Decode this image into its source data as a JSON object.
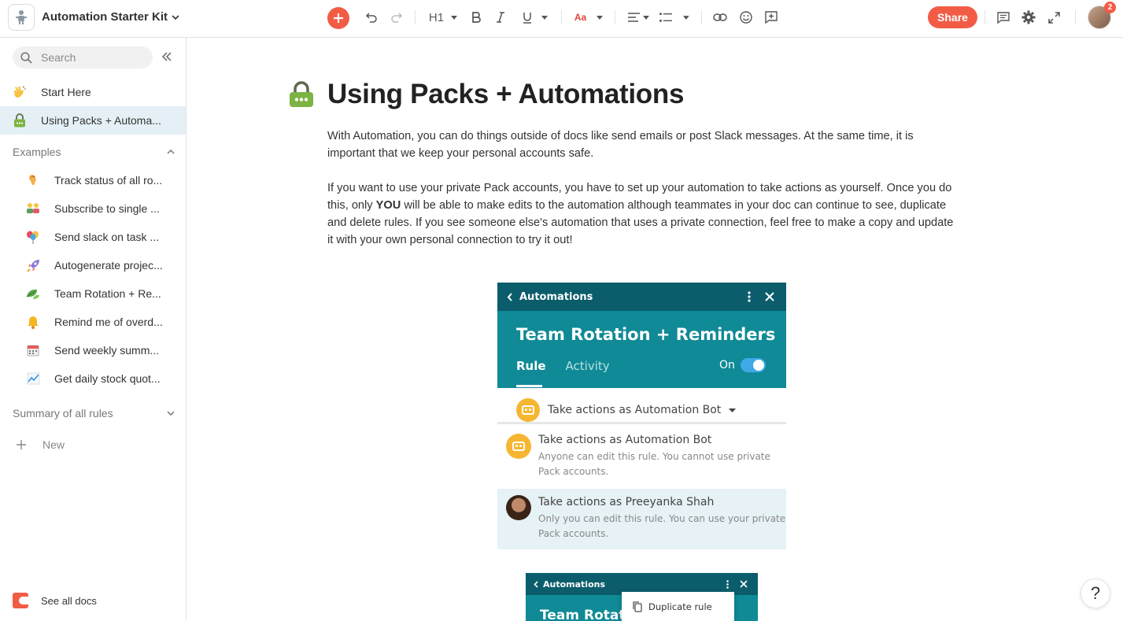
{
  "topbar": {
    "doc_title": "Automation Starter Kit",
    "heading_label": "H1",
    "font_label": "Aa",
    "share_label": "Share",
    "notification_count": "2",
    "accent_color": "#f25c45"
  },
  "sidebar": {
    "search_placeholder": "Search",
    "items": [
      {
        "icon": "waving-hand-icon",
        "label": "Start Here"
      },
      {
        "icon": "lock-icon",
        "label": "Using Packs + Automa..."
      }
    ],
    "examples_header": "Examples",
    "examples": [
      {
        "icon": "ear-icon",
        "label": "Track status of all ro..."
      },
      {
        "icon": "people-icon",
        "label": "Subscribe to single ..."
      },
      {
        "icon": "balloons-icon",
        "label": "Send slack on task ..."
      },
      {
        "icon": "rocket-icon",
        "label": "Autogenerate projec..."
      },
      {
        "icon": "leaves-icon",
        "label": "Team Rotation + Re..."
      },
      {
        "icon": "bell-icon",
        "label": "Remind me of overd..."
      },
      {
        "icon": "calendar-icon",
        "label": "Send weekly summ..."
      },
      {
        "icon": "chart-icon",
        "label": "Get daily stock quot..."
      }
    ],
    "summary_header": "Summary of all rules",
    "new_label": "New",
    "see_all_label": "See all docs"
  },
  "main": {
    "title": "Using Packs + Automations",
    "para1": "With Automation, you can do things outside of docs like send emails or post Slack messages.  At the same time, it is important that we keep your personal accounts safe.",
    "para2_before": "If you want to use your private Pack accounts, you have to set up your automation to take actions as yourself.  Once you do this, only ",
    "para2_bold": "YOU",
    "para2_after": " will be able to make edits to the automation although teammates in your doc can continue to see, duplicate and delete rules.  If you see someone else's automation that uses a private connection, feel free to make a copy and update it with your own personal connection to try it out!"
  },
  "screenshot1": {
    "header": "Automations",
    "title": "Team Rotation + Reminders",
    "tab_rule": "Rule",
    "tab_activity": "Activity",
    "on_label": "On",
    "selected": "Take actions as Automation Bot",
    "option1_title": "Take actions as Automation Bot",
    "option1_sub": "Anyone can edit this rule. You cannot use private Pack accounts.",
    "option2_title": "Take actions as Preeyanka Shah",
    "option2_sub": "Only you can edit this rule. You can use your private Pack accounts."
  },
  "screenshot2": {
    "header": "Automations",
    "title": "Team Rotati",
    "menu_item": "Duplicate rule"
  },
  "help_label": "?"
}
